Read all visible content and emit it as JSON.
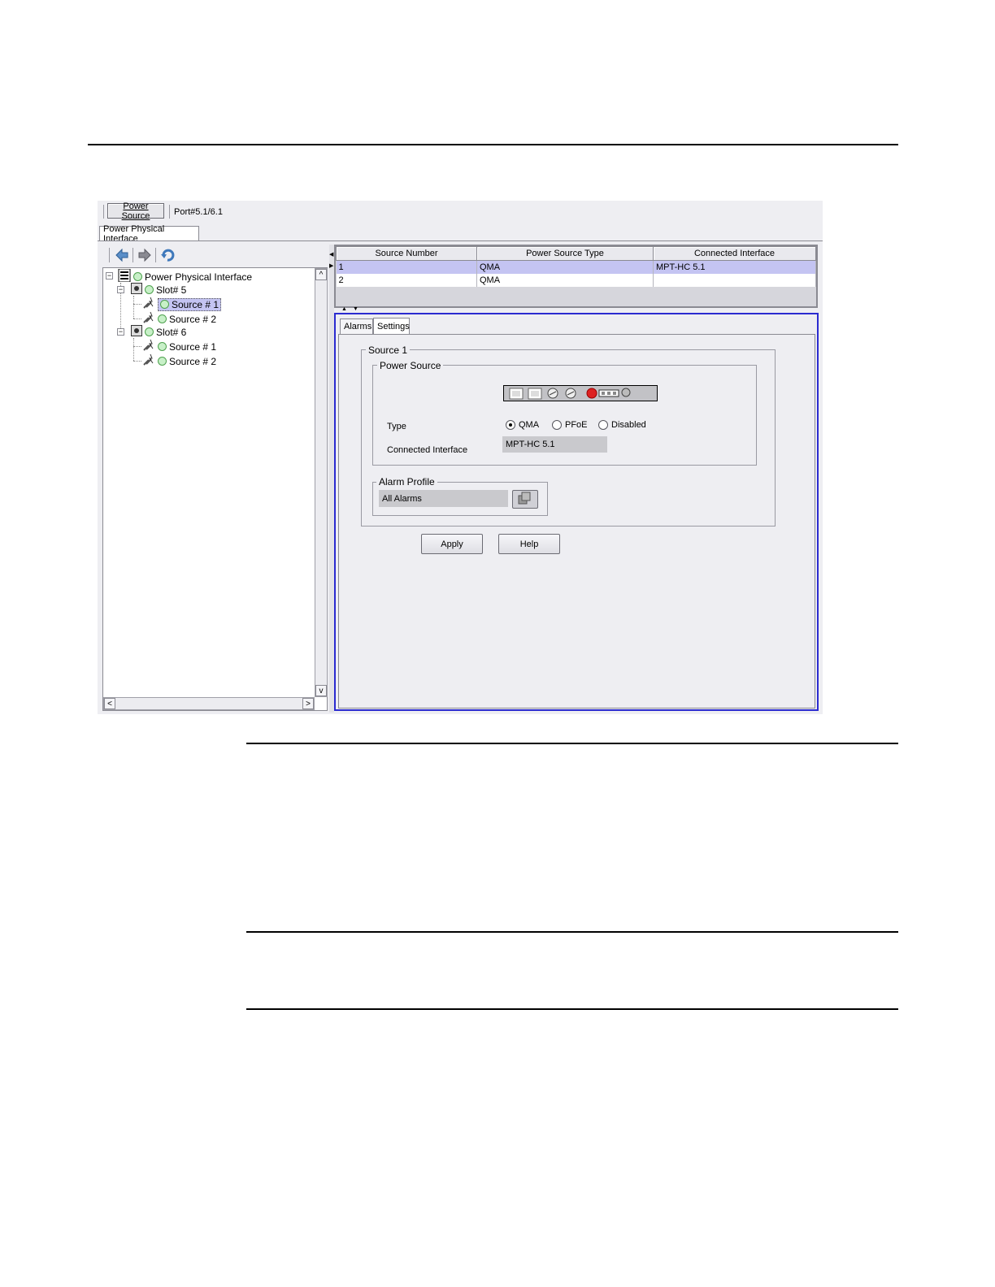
{
  "toolbar": {
    "power_source_label": "Power Source",
    "port_label": "Port#5.1/6.1"
  },
  "main_tab": {
    "label": "Power Physical Interface"
  },
  "tree": {
    "root": "Power Physical Interface",
    "slot5": {
      "label": "Slot# 5",
      "sources": [
        "Source # 1",
        "Source # 2"
      ]
    },
    "slot6": {
      "label": "Slot# 6",
      "sources": [
        "Source # 1",
        "Source # 2"
      ]
    }
  },
  "table": {
    "columns": [
      "Source Number",
      "Power Source Type",
      "Connected Interface"
    ],
    "rows": [
      [
        "1",
        "QMA",
        "MPT-HC 5.1"
      ],
      [
        "2",
        "QMA",
        ""
      ]
    ]
  },
  "sub_tabs": [
    "Alarms",
    "Settings"
  ],
  "settings": {
    "source_group": "Source 1",
    "power_source_group": "Power Source",
    "type_label": "Type",
    "type_options": [
      "QMA",
      "PFoE",
      "Disabled"
    ],
    "type_selected": "QMA",
    "connected_label": "Connected Interface",
    "connected_value": "MPT-HC 5.1",
    "alarm_group": "Alarm Profile",
    "alarm_value": "All Alarms",
    "apply_label": "Apply",
    "help_label": "Help"
  },
  "colors": {
    "selection": "#c4c4f2",
    "focus_border": "#2b2bd0",
    "led_green": "#c8f0c8"
  }
}
